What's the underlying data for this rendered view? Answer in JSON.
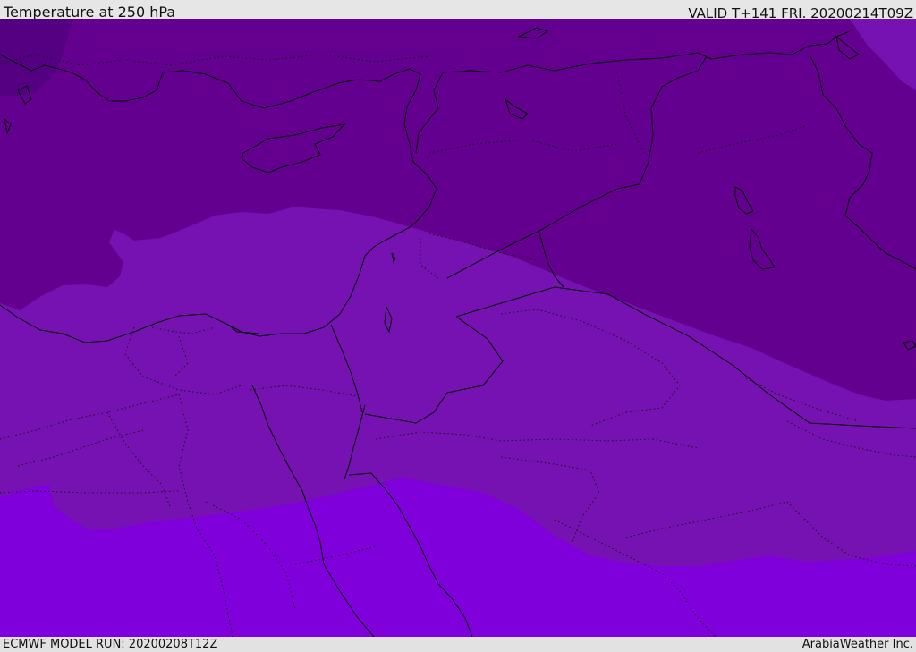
{
  "header": {
    "title": "Temperature at 250 hPa",
    "valid": "VALID T+141 FRI. 20200214T09Z"
  },
  "footer": {
    "model_run": "ECMWF MODEL RUN: 20200208T12Z",
    "credit": "ArabiaWeather Inc."
  },
  "map": {
    "colors": {
      "band_darkest": "#550082",
      "band_dark": "#64008f",
      "band_mid": "#7512b1",
      "band_bright": "#7f00db",
      "coastline": "#000000"
    }
  }
}
